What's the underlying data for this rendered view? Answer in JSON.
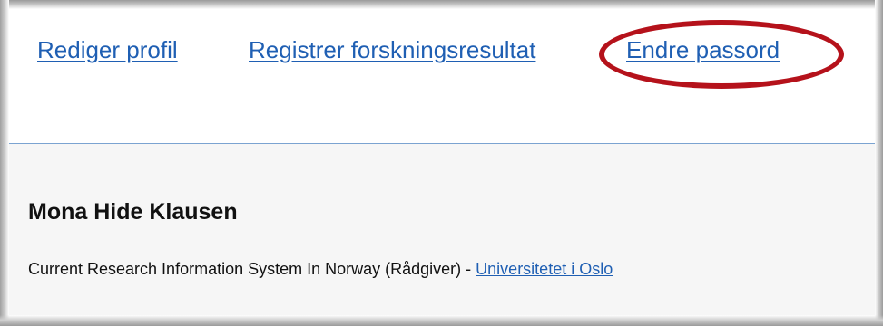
{
  "nav": {
    "links": [
      {
        "label": "Rediger profil"
      },
      {
        "label": "Registrer forskningsresultat"
      },
      {
        "label": "Endre passord"
      }
    ]
  },
  "profile": {
    "name": "Mona Hide Klausen",
    "description_text": "Current Research Information System In Norway (Rådgiver) - ",
    "organization": "Universitetet i Oslo"
  },
  "colors": {
    "link": "#1f5fb3",
    "highlight_circle": "#b5121b",
    "divider": "#7ba3d1",
    "content_background": "#f6f6f6"
  }
}
